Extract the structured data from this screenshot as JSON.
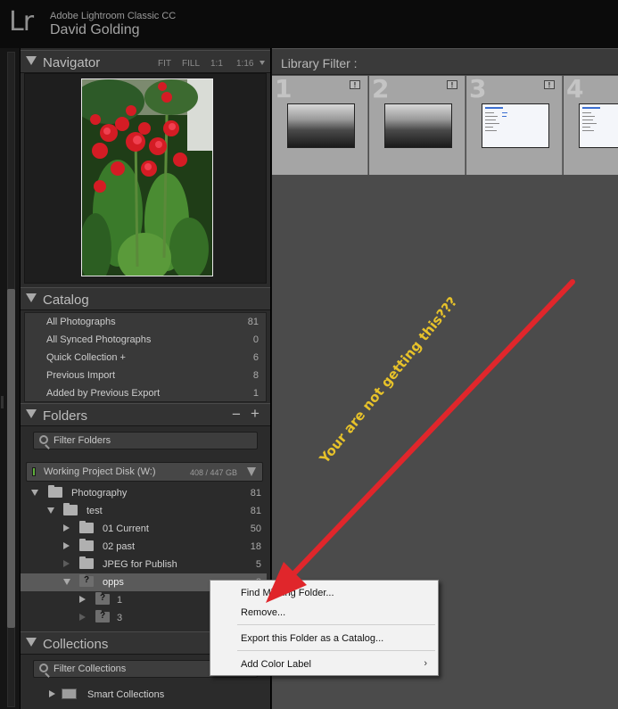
{
  "identity": {
    "logo": "Lr",
    "app_name": "Adobe Lightroom Classic CC",
    "user_name": "David Golding"
  },
  "navigator": {
    "title": "Navigator",
    "zoom_options": [
      "FIT",
      "FILL",
      "1:1",
      "1:16"
    ]
  },
  "catalog": {
    "title": "Catalog",
    "items": [
      {
        "label": "All Photographs",
        "count": "81"
      },
      {
        "label": "All Synced Photographs",
        "count": "0"
      },
      {
        "label": "Quick Collection  +",
        "count": "6"
      },
      {
        "label": "Previous Import",
        "count": "8"
      },
      {
        "label": "Added by Previous Export",
        "count": "1"
      }
    ]
  },
  "folders": {
    "title": "Folders",
    "minus": "−",
    "plus": "+",
    "filter_label": "Filter Folders",
    "volume": {
      "name": "Working Project Disk (W:)",
      "size": "408 / 447 GB",
      "status_color": "#5fae3b"
    },
    "tree": [
      {
        "label": "Photography",
        "count": "81"
      },
      {
        "label": "test",
        "count": "81"
      },
      {
        "label": "01 Current",
        "count": "50"
      },
      {
        "label": "02 past",
        "count": "18"
      },
      {
        "label": "JPEG for Publish",
        "count": "5"
      },
      {
        "label": "opps",
        "count": "8"
      },
      {
        "label": "1",
        "count": ""
      },
      {
        "label": "3",
        "count": ""
      }
    ],
    "missing_mark": "?"
  },
  "collections": {
    "title": "Collections",
    "filter_label": "Filter Collections",
    "items": [
      {
        "label": "Smart Collections"
      }
    ]
  },
  "library": {
    "filter_title": "Library Filter :",
    "cells": [
      {
        "number": "1",
        "flag": "!",
        "thumb": "bw"
      },
      {
        "number": "2",
        "flag": "!",
        "thumb": "bw"
      },
      {
        "number": "3",
        "flag": "!",
        "thumb": "doc"
      },
      {
        "number": "4",
        "flag": "",
        "thumb": "doc"
      }
    ]
  },
  "context_menu": {
    "items": [
      {
        "label": "Find Missing Folder..."
      },
      {
        "label": "Remove..."
      },
      {
        "label": "Export this Folder as a Catalog..."
      },
      {
        "label": "Add Color Label",
        "submenu_arrow": "›"
      }
    ]
  },
  "annotation": {
    "text": "Your are not getting this???",
    "arrow_color": "#e0262b",
    "text_color": "#e7c22a"
  }
}
